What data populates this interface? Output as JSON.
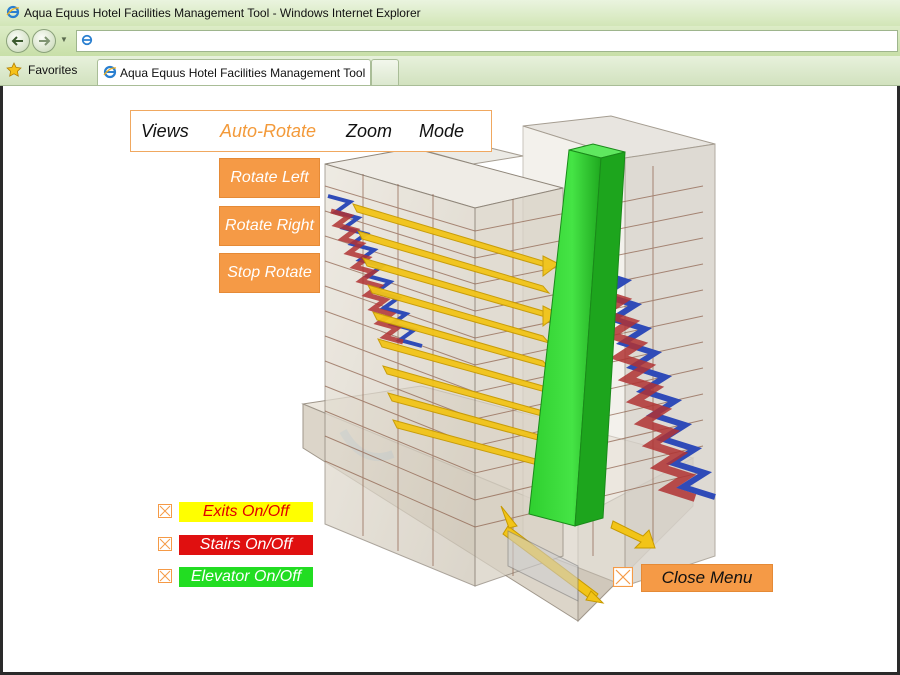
{
  "window": {
    "title": "Aqua Equus Hotel Facilities Management Tool - Windows Internet Explorer"
  },
  "tabs": {
    "favorites_label": "Favorites",
    "active_tab": "Aqua Equus Hotel Facilities Management Tool"
  },
  "menu": {
    "items": [
      "Views",
      "Auto-Rotate",
      "Zoom",
      "Mode"
    ],
    "active": "Auto-Rotate",
    "submenu": [
      "Rotate Left",
      "Rotate Right",
      "Stop Rotate"
    ]
  },
  "toggles": [
    {
      "label": "Exits On/Off",
      "bg": "#ffff00",
      "fg": "#e00000"
    },
    {
      "label": "Stairs On/Off",
      "bg": "#e01010",
      "fg": "#ffffff"
    },
    {
      "label": "Elevator On/Off",
      "bg": "#22dd22",
      "fg": "#ffffff"
    }
  ],
  "close_menu": {
    "label": "Close Menu"
  },
  "colors": {
    "accent": "#f59a46",
    "elevator": "#22cc22",
    "stairs": "#c03030",
    "exits": "#f2c418"
  }
}
